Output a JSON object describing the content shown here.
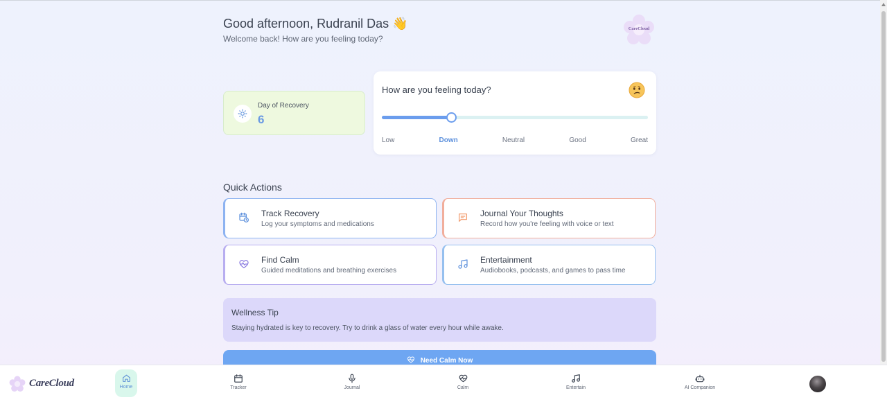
{
  "header": {
    "greeting": "Good afternoon, Rudranil Das",
    "wave_emoji": "👋",
    "subtitle": "Welcome back! How are you feeling today?",
    "logo_caption": "CareCloud"
  },
  "recovery": {
    "label": "Day of Recovery",
    "value": "6",
    "icon": "sun-icon"
  },
  "mood": {
    "question": "How are you feeling today?",
    "emoji": "😕",
    "slider_value_fraction": 0.26,
    "labels": [
      "Low",
      "Down",
      "Neutral",
      "Good",
      "Great"
    ],
    "selected": "Down"
  },
  "quick_actions": {
    "title": "Quick Actions",
    "items": [
      {
        "title": "Track Recovery",
        "subtitle": "Log your symptoms and medications",
        "icon": "calendar-clock-icon",
        "accent": "#5b8fdc"
      },
      {
        "title": "Journal Your Thoughts",
        "subtitle": "Record how you're feeling with voice or text",
        "icon": "message-icon",
        "accent": "#f29a6b"
      },
      {
        "title": "Find Calm",
        "subtitle": "Guided meditations and breathing exercises",
        "icon": "heart-pulse-icon",
        "accent": "#8a7be0"
      },
      {
        "title": "Entertainment",
        "subtitle": "Audiobooks, podcasts, and games to pass time",
        "icon": "music-icon",
        "accent": "#5b8fdc"
      }
    ]
  },
  "tip": {
    "title": "Wellness Tip",
    "text": "Staying hydrated is key to recovery. Try to drink a glass of water every hour while awake."
  },
  "calm_button": {
    "label": "Need Calm Now",
    "icon": "heart-pulse-icon"
  },
  "nav": {
    "brand": "CareCloud",
    "items": [
      {
        "label": "Home",
        "icon": "home-icon",
        "active": true
      },
      {
        "label": "Tracker",
        "icon": "calendar-icon"
      },
      {
        "label": "Journal",
        "icon": "mic-icon"
      },
      {
        "label": "Calm",
        "icon": "heart-pulse-icon"
      },
      {
        "label": "Entertain",
        "icon": "music-icon"
      },
      {
        "label": "AI Companion",
        "icon": "bot-icon"
      }
    ]
  },
  "colors": {
    "accent_blue": "#6b9ded",
    "recovery_bg": "#eef9df",
    "tip_bg": "#dcd8fa",
    "calm_button": "#6ea6f2"
  }
}
